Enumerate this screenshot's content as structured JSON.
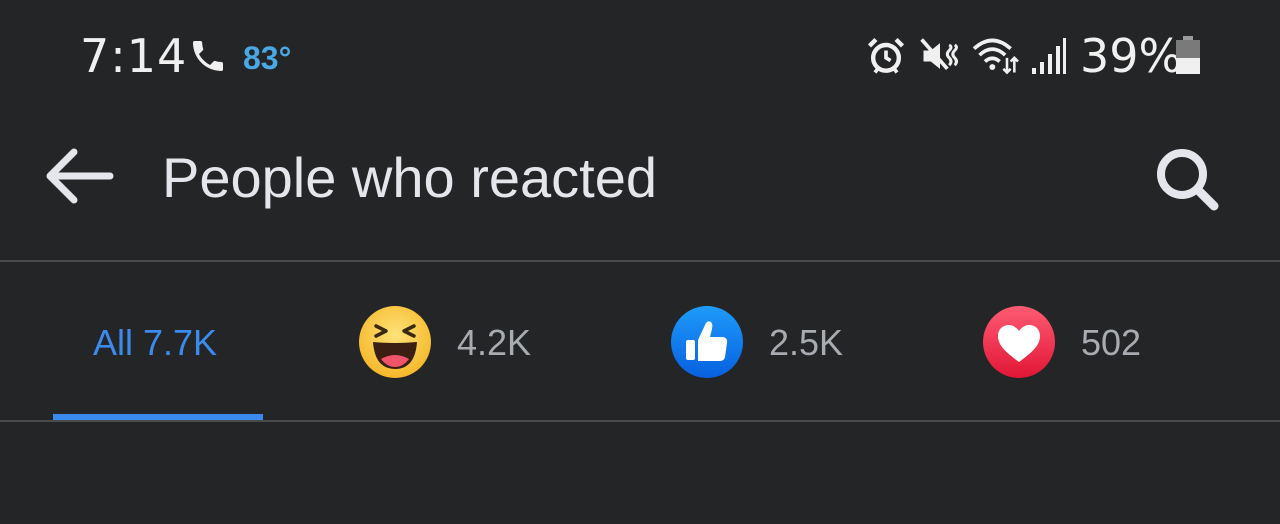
{
  "status_bar": {
    "time": "7:14",
    "weather_temp": "83°",
    "battery_percent": "39%",
    "icons": [
      "call-icon",
      "alarm-icon",
      "mute-vibrate-icon",
      "wifi-icon",
      "signal-icon",
      "battery-icon"
    ]
  },
  "header": {
    "title": "People who reacted",
    "back_icon": "arrow-left-icon",
    "search_icon": "search-icon"
  },
  "tabs": [
    {
      "id": "all",
      "label": "All 7.7K",
      "selected": true
    },
    {
      "id": "haha",
      "icon": "haha-emoji-icon",
      "count": "4.2K",
      "selected": false
    },
    {
      "id": "like",
      "icon": "like-thumb-icon",
      "count": "2.5K",
      "selected": false
    },
    {
      "id": "love",
      "icon": "love-heart-icon",
      "count": "502",
      "selected": false
    }
  ],
  "colors": {
    "background": "#242526",
    "accent": "#3b8bef",
    "text_primary": "#e4e6eb",
    "text_secondary": "#a8abaf",
    "weather": "#4aa8e6",
    "like_blue": "#1877f2",
    "love_red": "#f0284a",
    "haha_yellow": "#f7c73d"
  }
}
